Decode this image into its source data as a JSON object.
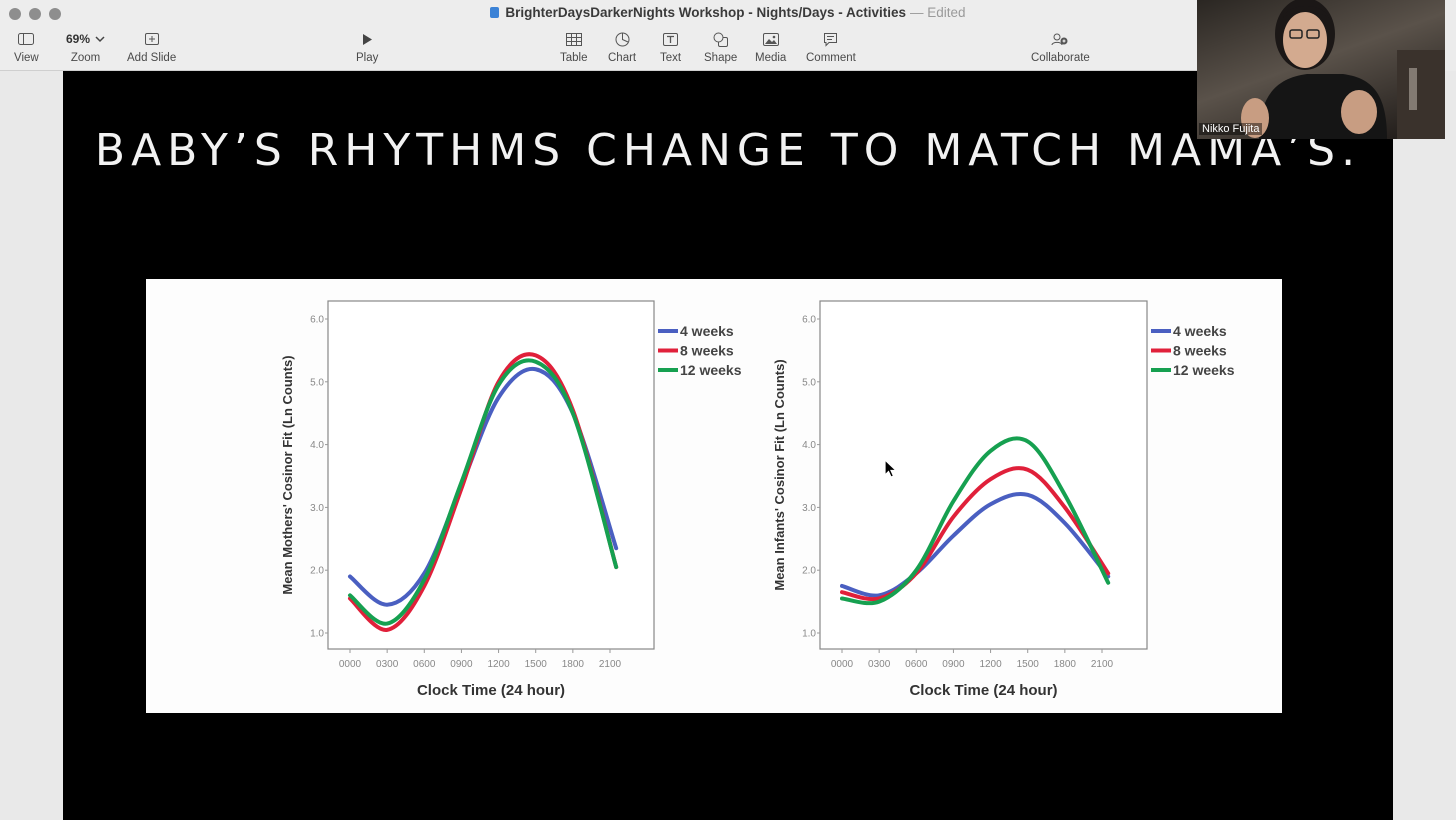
{
  "window": {
    "title": "BrighterDaysDarkerNights Workshop - Nights/Days - Activities",
    "status": "— Edited"
  },
  "toolbar": {
    "view_label": "View",
    "zoom_value": "69%",
    "zoom_label": "Zoom",
    "add_slide_label": "Add Slide",
    "play_label": "Play",
    "table_label": "Table",
    "chart_label": "Chart",
    "text_label": "Text",
    "shape_label": "Shape",
    "media_label": "Media",
    "comment_label": "Comment",
    "collaborate_label": "Collaborate"
  },
  "slide": {
    "title": "BABY’S RHYTHMS CHANGE TO MATCH MAMA’S."
  },
  "video": {
    "speaker_name": "Nikko Fujita"
  },
  "chart_data": [
    {
      "type": "line",
      "ylabel": "Mean Mothers' Cosinor Fit (Ln Counts)",
      "xlabel": "Clock Time (24 hour)",
      "ylim": [
        1.0,
        6.0
      ],
      "yticks": [
        "1.0",
        "2.0",
        "3.0",
        "4.0",
        "5.0",
        "6.0"
      ],
      "xticks": [
        "0000",
        "0300",
        "0600",
        "0900",
        "1200",
        "1500",
        "1800",
        "2100"
      ],
      "x": [
        0,
        3,
        6,
        9,
        12,
        15,
        18,
        21.5
      ],
      "legend_position": "top-right",
      "series": [
        {
          "name": "4 weeks",
          "color": "#4a5fc1",
          "values": [
            1.9,
            1.45,
            1.95,
            3.35,
            4.75,
            5.2,
            4.5,
            2.35
          ]
        },
        {
          "name": "8 weeks",
          "color": "#e0203a",
          "values": [
            1.55,
            1.05,
            1.75,
            3.3,
            5.0,
            5.42,
            4.55,
            2.05
          ]
        },
        {
          "name": "12 weeks",
          "color": "#16a050",
          "values": [
            1.6,
            1.15,
            1.85,
            3.4,
            4.95,
            5.32,
            4.5,
            2.05
          ]
        }
      ]
    },
    {
      "type": "line",
      "ylabel": "Mean Infants' Cosinor Fit (Ln Counts)",
      "xlabel": "Clock Time (24 hour)",
      "ylim": [
        1.0,
        6.0
      ],
      "yticks": [
        "1.0",
        "2.0",
        "3.0",
        "4.0",
        "5.0",
        "6.0"
      ],
      "xticks": [
        "0000",
        "0300",
        "0600",
        "0900",
        "1200",
        "1500",
        "1800",
        "2100"
      ],
      "x": [
        0,
        3,
        6,
        9,
        12,
        15,
        18,
        21.5
      ],
      "legend_position": "top-right",
      "series": [
        {
          "name": "4 weeks",
          "color": "#4a5fc1",
          "values": [
            1.75,
            1.6,
            1.95,
            2.55,
            3.05,
            3.2,
            2.75,
            1.9
          ]
        },
        {
          "name": "8 weeks",
          "color": "#e0203a",
          "values": [
            1.65,
            1.55,
            1.95,
            2.85,
            3.45,
            3.6,
            3.0,
            1.95
          ]
        },
        {
          "name": "12 weeks",
          "color": "#16a050",
          "values": [
            1.55,
            1.5,
            2.0,
            3.1,
            3.9,
            4.05,
            3.2,
            1.8
          ]
        }
      ]
    }
  ]
}
